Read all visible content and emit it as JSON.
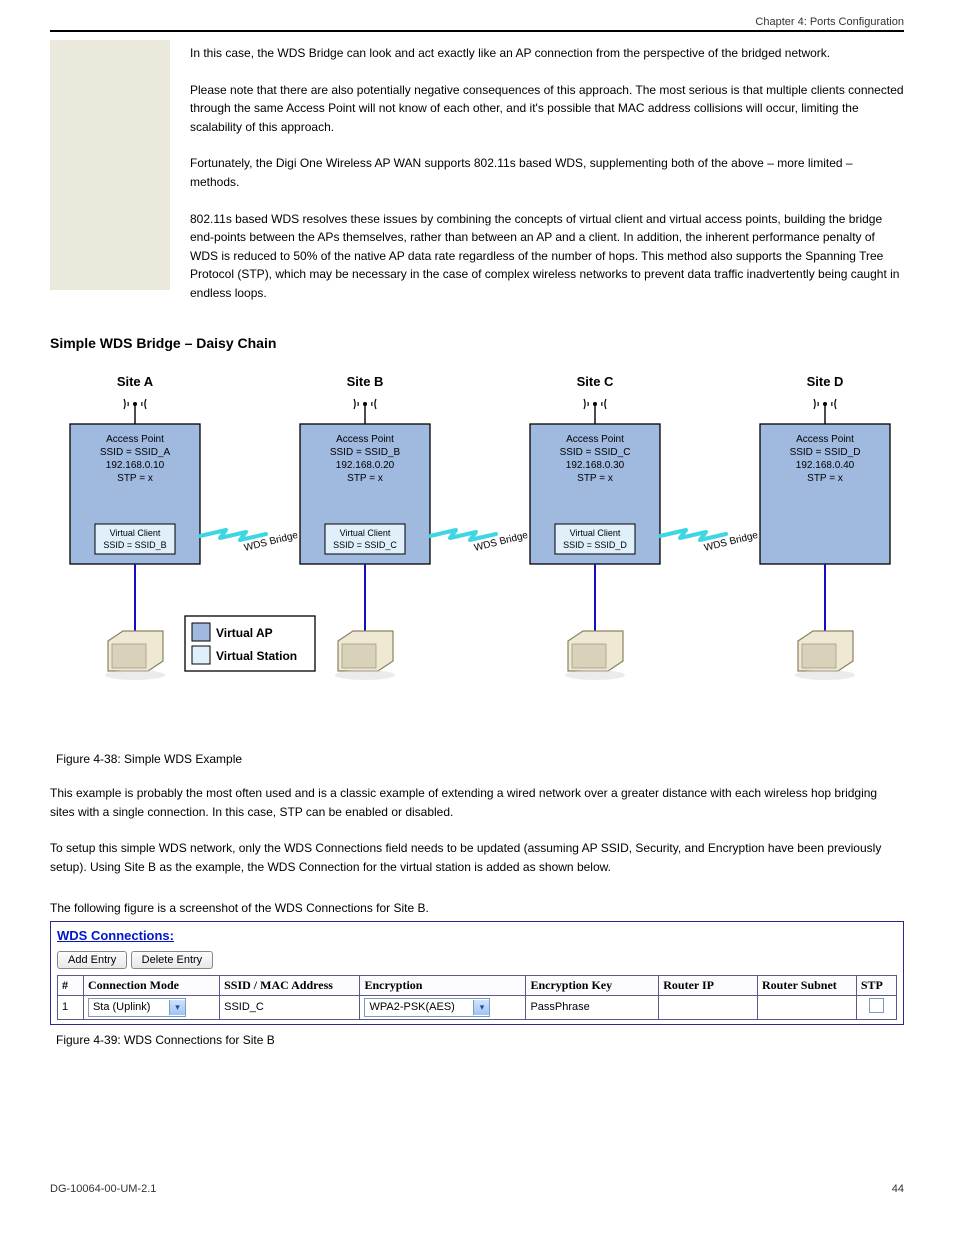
{
  "header": {
    "right": "Chapter 4: Ports Configuration"
  },
  "intro": {
    "p1": "In this case, the WDS Bridge can look and act exactly like an AP connection from the perspective of the bridged network.",
    "p2": "Please note that there are also potentially negative consequences of this approach. The most serious is that multiple clients connected through the same Access Point will not know of each other, and it's possible that MAC address collisions will occur, limiting the scalability of this approach.",
    "p3": "Fortunately, the Digi One Wireless AP WAN supports 802.11s based WDS, supplementing both of the above – more limited – methods.",
    "p4": "802.11s based WDS resolves these issues by combining the concepts of virtual client and virtual access points, building the bridge end-points between the APs themselves, rather than between an AP and a client. In addition, the inherent performance penalty of WDS is reduced to 50% of the native AP data rate regardless of the number of hops. This method also supports the Spanning Tree Protocol (STP), which may be necessary in the case of complex wireless networks to prevent data traffic inadvertently being caught in endless loops."
  },
  "section": {
    "title": "Simple WDS Bridge – Daisy Chain"
  },
  "diagram": {
    "sites": [
      {
        "label": "Site A",
        "ap": "Access Point",
        "ssid": "SSID  = SSID_A",
        "ip": "192.168.0.10",
        "stp": "STP = x",
        "vc_line1": "Virtual Client",
        "vc_line2": "SSID = SSID_B"
      },
      {
        "label": "Site B",
        "ap": "Access Point",
        "ssid": "SSID  = SSID_B",
        "ip": "192.168.0.20",
        "stp": "STP = x",
        "vc_line1": "Virtual Client",
        "vc_line2": "SSID = SSID_C"
      },
      {
        "label": "Site C",
        "ap": "Access Point",
        "ssid": "SSID  = SSID_C",
        "ip": "192.168.0.30",
        "stp": "STP = x",
        "vc_line1": "Virtual Client",
        "vc_line2": "SSID = SSID_D"
      },
      {
        "label": "Site D",
        "ap": "Access Point",
        "ssid": "SSID  = SSID_D",
        "ip": "192.168.0.40",
        "stp": "STP = x",
        "vc_line1": "",
        "vc_line2": ""
      }
    ],
    "link_label": "WDS  Bridge",
    "legend": {
      "vap": "Virtual AP",
      "vstation": "Virtual Station"
    }
  },
  "fig_caption": "Figure 4-38: Simple WDS Example",
  "body2": {
    "p1": "This example is probably the most often used and is a classic example of extending a wired network over a greater distance with each wireless hop bridging sites with a single connection. In this case, STP can be enabled or disabled.",
    "p2": "To setup this simple WDS network, only the WDS Connections field needs to be updated (assuming AP SSID, Security, and Encryption have been previously setup). Using Site B as the example, the WDS Connection for the virtual station is added as shown below."
  },
  "screenshot_caption": "The following figure is a screenshot of the WDS Connections for Site B.",
  "wds": {
    "title": "WDS Connections:",
    "buttons": {
      "add": "Add Entry",
      "delete": "Delete Entry"
    },
    "columns": {
      "num": "#",
      "mode": "Connection Mode",
      "ssid": "SSID / MAC Address",
      "enc": "Encryption",
      "key": "Encryption Key",
      "rip": "Router IP",
      "rsub": "Router Subnet",
      "stp": "STP"
    },
    "row": {
      "num": "1",
      "mode": "Sta (Uplink)",
      "ssid": "SSID_C",
      "enc": "WPA2-PSK(AES)",
      "key": "PassPhrase",
      "rip": "",
      "rsub": ""
    }
  },
  "fig2_caption": "Figure 4-39: WDS Connections for Site B",
  "footer": {
    "left": "DG-10064-00-UM-2.1",
    "right": "44"
  }
}
